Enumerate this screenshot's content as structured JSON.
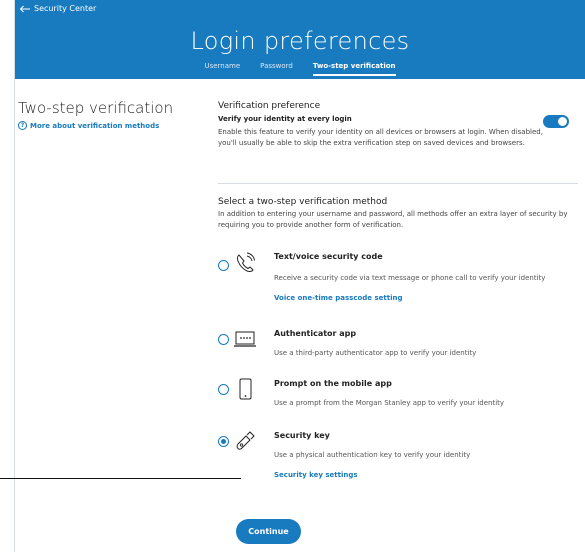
{
  "header": {
    "back_label": "Security Center",
    "title": "Login preferences",
    "tabs": [
      {
        "label": "Username"
      },
      {
        "label": "Password"
      },
      {
        "label": "Two-step verification"
      }
    ]
  },
  "left": {
    "title": "Two-step verification",
    "link": "More about verification methods"
  },
  "preference": {
    "heading": "Verification preference",
    "subheading": "Verify your identity at every login",
    "description": "Enable this feature to verify your identity on all devices or browsers at login. When disabled, you'll usually be able to skip the extra verification step on saved devices and browsers.",
    "toggle_on": true
  },
  "methods": {
    "heading": "Select a two-step verification method",
    "description": "In addition to entering your username and password, all methods offer an extra layer of security by requiring you to provide another form of verification.",
    "options": [
      {
        "title": "Text/voice security code",
        "desc": "Receive a security code via text message or phone call to verify your identity",
        "link": "Voice one-time passcode setting",
        "icon": "phone-call-icon",
        "selected": false
      },
      {
        "title": "Authenticator app",
        "desc": "Use a third-party authenticator app to verify your identity",
        "icon": "laptop-icon",
        "selected": false
      },
      {
        "title": "Prompt on the mobile app",
        "desc": "Use a prompt from the Morgan Stanley app to verify your identity",
        "icon": "mobile-phone-icon",
        "selected": false
      },
      {
        "title": "Security key",
        "desc": "Use a physical authentication key to verify your identity",
        "link": "Security key settings",
        "icon": "usb-key-icon",
        "selected": true
      }
    ]
  },
  "continue_label": "Continue",
  "colors": {
    "accent": "#187abf"
  }
}
